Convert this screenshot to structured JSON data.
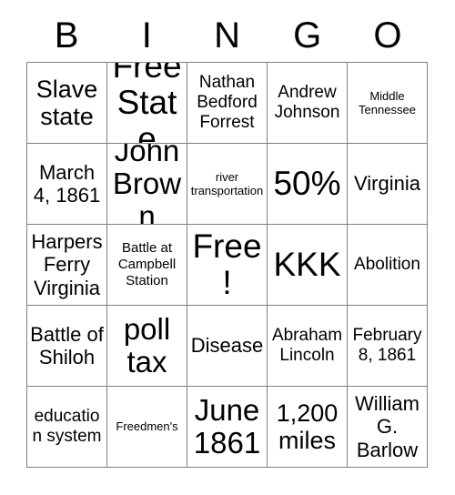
{
  "card": {
    "title": "BINGO",
    "header_letters": [
      "B",
      "I",
      "N",
      "G",
      "O"
    ],
    "border_color": "#808080",
    "cell_background": "#ffffff",
    "text_color": "#000000",
    "grid_size": "5x5",
    "free_space_label": "Free!",
    "free_space_position": "row3-col3",
    "rows": [
      [
        {
          "text": "Slave state",
          "size": "xl"
        },
        {
          "text": "Free State",
          "size": "huge"
        },
        {
          "text": "Nathan Bedford Forrest",
          "size": "m"
        },
        {
          "text": "Andrew Johnson",
          "size": "m"
        },
        {
          "text": "Middle Tennessee",
          "size": "xs"
        }
      ],
      [
        {
          "text": "March 4, 1861",
          "size": "l"
        },
        {
          "text": "John Brown",
          "size": "xxl"
        },
        {
          "text": "river transportation",
          "size": "xs"
        },
        {
          "text": "50%",
          "size": "huge"
        },
        {
          "text": "Virginia",
          "size": "l"
        }
      ],
      [
        {
          "text": "Harpers Ferry Virginia",
          "size": "l"
        },
        {
          "text": "Battle at Campbell Station",
          "size": "s"
        },
        {
          "text": "Free!",
          "size": "huge"
        },
        {
          "text": "KKK",
          "size": "huge"
        },
        {
          "text": "Abolition",
          "size": "m"
        }
      ],
      [
        {
          "text": "Battle of Shiloh",
          "size": "l"
        },
        {
          "text": "poll tax",
          "size": "xxl"
        },
        {
          "text": "Disease",
          "size": "l"
        },
        {
          "text": "Abraham Lincoln",
          "size": "m"
        },
        {
          "text": "February 8, 1861",
          "size": "m"
        }
      ],
      [
        {
          "text": "education system",
          "size": "m"
        },
        {
          "text": "Freedmen's",
          "size": "xs"
        },
        {
          "text": "June 1861",
          "size": "xxl"
        },
        {
          "text": "1,200 miles",
          "size": "xl"
        },
        {
          "text": "William G. Barlow",
          "size": "l"
        }
      ]
    ]
  }
}
